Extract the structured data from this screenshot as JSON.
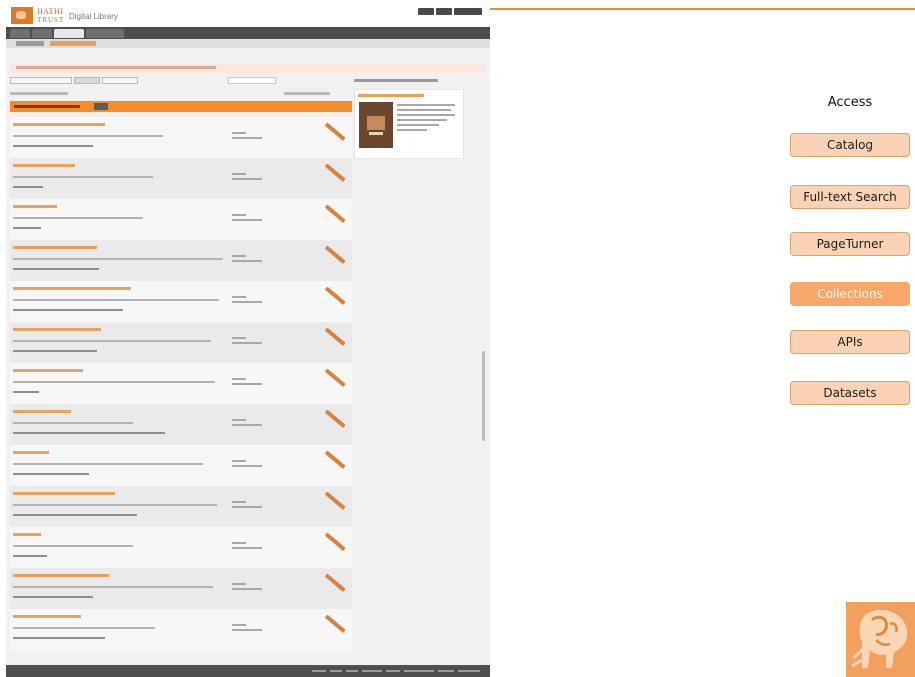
{
  "access": {
    "title": "Access",
    "items": [
      {
        "label": "Catalog",
        "active": false
      },
      {
        "label": "Full-text Search",
        "active": false
      },
      {
        "label": "PageTurner",
        "active": false
      },
      {
        "label": "Collections",
        "active": true
      },
      {
        "label": "APIs",
        "active": false
      },
      {
        "label": "Datasets",
        "active": false
      }
    ]
  },
  "screenshot": {
    "brand_line1": "HATHI",
    "brand_line2": "TRUST",
    "brand_subtitle": "Digital Library"
  },
  "colors": {
    "accent": "#f6a769",
    "button_fill": "#fbd3b4",
    "button_border": "#e0a06b",
    "rule": "#e98b3c",
    "screenshot_bar": "#f08c2a"
  },
  "icons": {
    "logo": "elephant-logo-icon"
  }
}
